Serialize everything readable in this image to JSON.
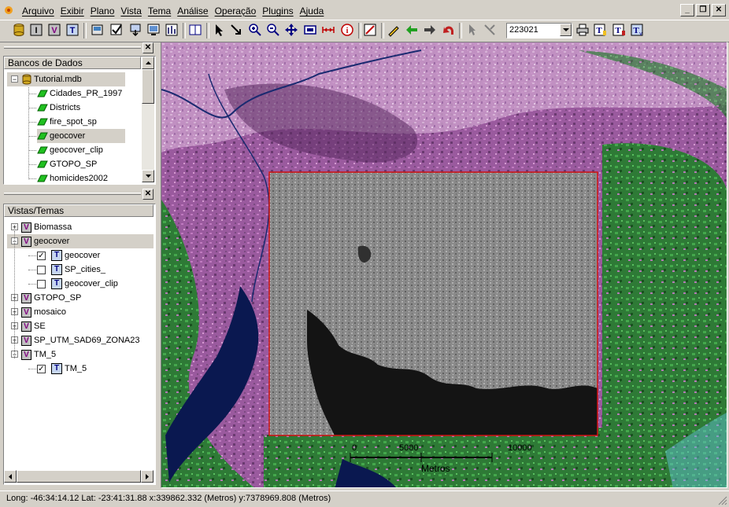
{
  "menu": [
    "Arquivo",
    "Exibir",
    "Plano",
    "Vista",
    "Tema",
    "Análise",
    "Operação",
    "Plugins",
    "Ajuda"
  ],
  "window_controls": {
    "minimize": "_",
    "restore": "❐",
    "close": "✕"
  },
  "toolbar": {
    "scale_value": "223021",
    "icons": [
      "database-icon",
      "info-layer-icon",
      "view-icon",
      "theme-icon",
      "print-layout-icon",
      "check-edit-icon",
      "import-icon",
      "display-icon",
      "chart-icon",
      "split-view-icon",
      "pointer-icon",
      "zoom-area-icon",
      "zoom-in-icon",
      "zoom-out-icon",
      "pan-icon",
      "zoom-extent-icon",
      "measure-icon",
      "info-icon",
      "delete-icon",
      "draw-icon",
      "back-icon",
      "forward-icon",
      "undo-icon",
      "select-icon",
      "edit-point-icon",
      "print-icon",
      "text-icon",
      "text-format-icon",
      "text-v-icon"
    ]
  },
  "databases": {
    "header": "Bancos de Dados",
    "root": "Tutorial.mdb",
    "layers": [
      "Cidades_PR_1997",
      "Districts",
      "fire_spot_sp",
      "geocover",
      "geocover_clip",
      "GTOPO_SP",
      "homicides2002"
    ],
    "selected": "geocover"
  },
  "views": {
    "header": "Vistas/Temas",
    "items": [
      {
        "type": "view",
        "label": "Biomassa",
        "expander": "+",
        "level": 0
      },
      {
        "type": "view",
        "label": "geocover",
        "expander": "−",
        "level": 0,
        "selected": true
      },
      {
        "type": "theme",
        "label": "geocover",
        "checked": true,
        "level": 1
      },
      {
        "type": "theme",
        "label": "SP_cities_",
        "checked": false,
        "level": 1
      },
      {
        "type": "theme",
        "label": "geocover_clip",
        "checked": false,
        "level": 1
      },
      {
        "type": "view",
        "label": "GTOPO_SP",
        "expander": "+",
        "level": 0
      },
      {
        "type": "view",
        "label": "mosaico",
        "expander": "+",
        "level": 0
      },
      {
        "type": "view",
        "label": "SE",
        "expander": "+",
        "level": 0
      },
      {
        "type": "view",
        "label": "SP_UTM_SAD69_ZONA23",
        "expander": "+",
        "level": 0
      },
      {
        "type": "view",
        "label": "TM_5",
        "expander": "−",
        "level": 0
      },
      {
        "type": "theme",
        "label": "TM_5",
        "checked": true,
        "level": 1
      }
    ]
  },
  "map": {
    "scalebar": {
      "labels": [
        "0",
        "5000",
        "10000"
      ],
      "unit": "Metros"
    }
  },
  "status": "Long: -46:34:14.12 Lat: -23:41:31.88  x:339862.332 (Metros)  y:7378969.808 (Metros)",
  "colors": {
    "extent_box": "#d01010",
    "water": "#0a1850",
    "vegetation": "#2a8a3a",
    "urban": "#a05aa8"
  }
}
